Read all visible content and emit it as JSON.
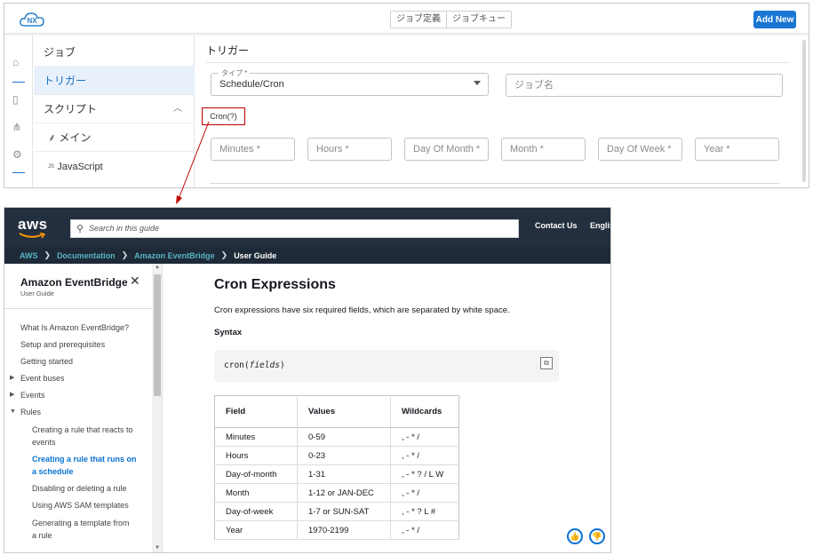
{
  "app": {
    "logo_text": "NX",
    "header_tabs": [
      "ジョブ定義",
      "ジョブキュー"
    ],
    "add_new_label": "Add New",
    "menu": {
      "job": "ジョブ",
      "trigger": "トリガー",
      "script": "スクリプト",
      "main_script": "メイン",
      "javascript_prefix": "JS",
      "javascript": "JavaScript"
    },
    "trigger_title": "トリガー",
    "type_field": {
      "label": "タイプ *",
      "value": "Schedule/Cron"
    },
    "job_name_placeholder": "ジョブ名",
    "cron_link": "Cron(?)",
    "cron_fields": [
      "Minutes *",
      "Hours *",
      "Day Of Month *",
      "Month *",
      "Day Of Week *",
      "Year *"
    ]
  },
  "doc": {
    "logo": "aws",
    "search_placeholder": "Search in this guide",
    "contact": "Contact Us",
    "language": "Englis",
    "breadcrumb": [
      "AWS",
      "Documentation",
      "Amazon EventBridge",
      "User Guide"
    ],
    "sidebar": {
      "title": "Amazon EventBridge",
      "subtitle": "User Guide",
      "items": [
        {
          "label": "What Is Amazon EventBridge?"
        },
        {
          "label": "Setup and prerequisites"
        },
        {
          "label": "Getting started"
        },
        {
          "label": "Event buses"
        },
        {
          "label": "Events"
        },
        {
          "label": "Rules"
        },
        {
          "label": "Creating a rule that reacts to events"
        },
        {
          "label": "Creating a rule that runs on a schedule"
        },
        {
          "label": "Disabling or deleting a rule"
        },
        {
          "label": "Using AWS SAM templates"
        },
        {
          "label": "Generating a template from a rule"
        }
      ]
    },
    "content": {
      "title": "Cron Expressions",
      "paragraph": "Cron expressions have six required fields, which are separated by white space.",
      "syntax_heading": "Syntax",
      "code_prefix": "cron(",
      "code_arg": "fields",
      "code_suffix": ")",
      "table": {
        "headers": [
          "Field",
          "Values",
          "Wildcards"
        ],
        "rows": [
          [
            "Minutes",
            "0-59",
            ", - * /"
          ],
          [
            "Hours",
            "0-23",
            ", - * /"
          ],
          [
            "Day-of-month",
            "1-31",
            ", - * ? / L W"
          ],
          [
            "Month",
            "1-12 or JAN-DEC",
            ", - * /"
          ],
          [
            "Day-of-week",
            "1-7 or SUN-SAT",
            ", - * ? L #"
          ],
          [
            "Year",
            "1970-2199",
            ", - * /"
          ]
        ]
      }
    }
  }
}
